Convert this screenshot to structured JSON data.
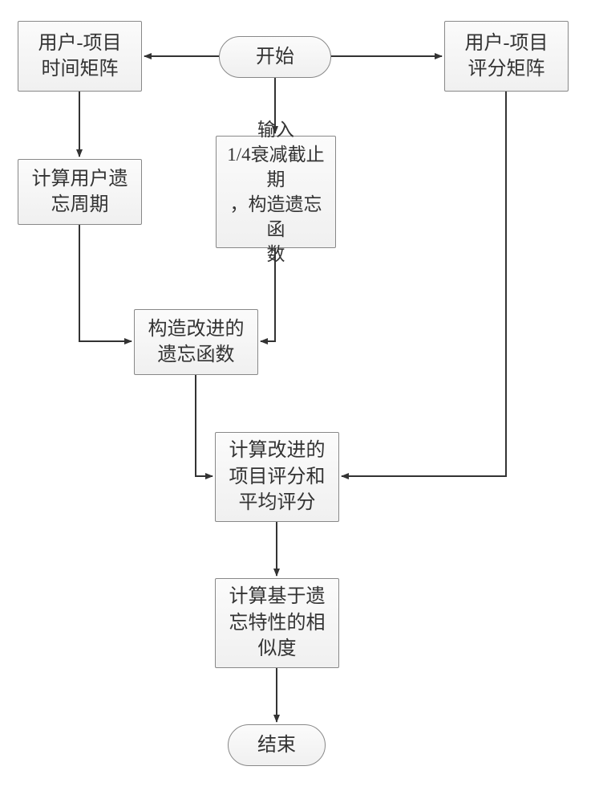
{
  "nodes": {
    "start": "开始",
    "timeMatrix": "用户-项目\n时间矩阵",
    "ratingMatrix": "用户-项目\n评分矩阵",
    "decayInput": "输入\n1/4衰减截止期\n，构造遗忘函\n数",
    "userForgetPeriod": "计算用户遗\n忘周期",
    "improvedForget": "构造改进的\n遗忘函数",
    "calcImproved": "计算改进的\n项目评分和\n平均评分",
    "similarity": "计算基于遗\n忘特性的相\n似度",
    "end": "结束"
  }
}
